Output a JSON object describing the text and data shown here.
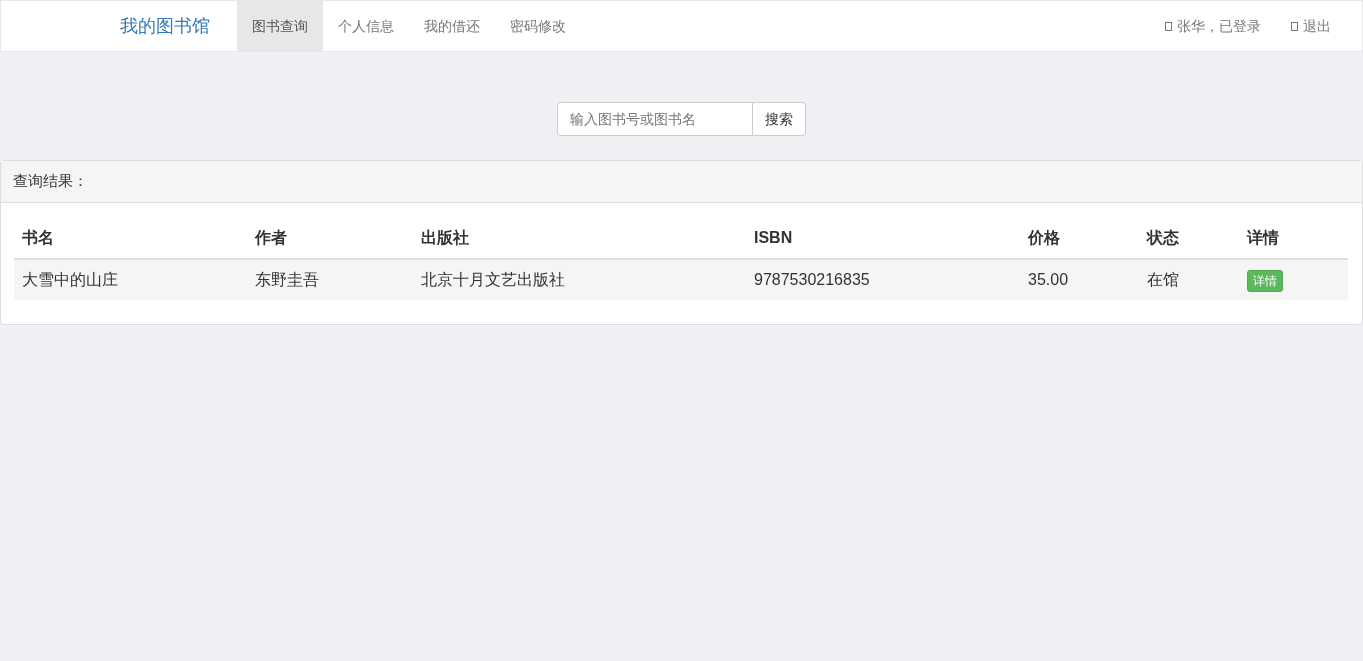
{
  "navbar": {
    "brand": "我的图书馆",
    "items": [
      {
        "label": "图书查询",
        "selected": true
      },
      {
        "label": "个人信息",
        "selected": false
      },
      {
        "label": "我的借还",
        "selected": false
      },
      {
        "label": "密码修改",
        "selected": false
      }
    ],
    "right_items": [
      "张华，已登录",
      "退出"
    ]
  },
  "search": {
    "placeholder": "输入图书号或图书名",
    "button": "搜索"
  },
  "results": {
    "title": "查询结果：",
    "columns": [
      "书名",
      "作者",
      "出版社",
      "ISBN",
      "价格",
      "状态",
      "详情"
    ],
    "rows": [
      {
        "cells": [
          "大雪中的山庄",
          "东野圭吾",
          "北京十月文艺出版社",
          "9787530216835",
          "35.00",
          "在馆"
        ],
        "action": "详情"
      }
    ]
  }
}
